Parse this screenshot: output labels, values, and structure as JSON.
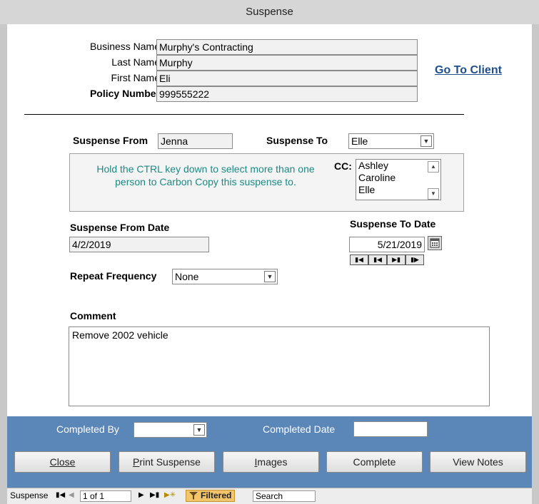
{
  "window": {
    "title": "Suspense"
  },
  "client": {
    "business_name_label": "Business Name",
    "business_name": "Murphy's Contracting",
    "last_name_label": "Last Name",
    "last_name": "Murphy",
    "first_name_label": "First Name",
    "first_name": "Eli",
    "policy_number_label": "Policy Number",
    "policy_number": "999555222",
    "go_to_client": "Go To Client"
  },
  "suspense": {
    "from_label": "Suspense From",
    "from": "Jenna",
    "to_label": "Suspense To",
    "to": "Elle",
    "cc_note": "Hold the CTRL key down to select more than one person to Carbon Copy this suspense to.",
    "cc_label": "CC:",
    "cc_options": [
      "Ashley",
      "Caroline",
      "Elle"
    ],
    "from_date_label": "Suspense From Date",
    "from_date": "4/2/2019",
    "to_date_label": "Suspense To Date",
    "to_date": "5/21/2019",
    "repeat_label": "Repeat Frequency",
    "repeat": "None",
    "comment_label": "Comment",
    "comment": "Remove 2002 vehicle"
  },
  "footer": {
    "completed_by_label": "Completed By",
    "completed_by": "",
    "completed_date_label": "Completed Date",
    "completed_date": "",
    "buttons": {
      "close": "Close",
      "print_pre": "",
      "print_key": "P",
      "print_rest": "rint Suspense",
      "images_key": "I",
      "images_rest": "mages",
      "complete": "Complete",
      "view_notes": "View Notes"
    }
  },
  "statusbar": {
    "record_label": "Suspense",
    "record_position": "1 of 1",
    "filter_status": "Filtered",
    "search_placeholder": "Search"
  },
  "colors": {
    "footer_bg": "#5b86b8",
    "note_text": "#1b8a83",
    "link": "#1f4f8f",
    "filtered_bg": "#f2c46b"
  }
}
